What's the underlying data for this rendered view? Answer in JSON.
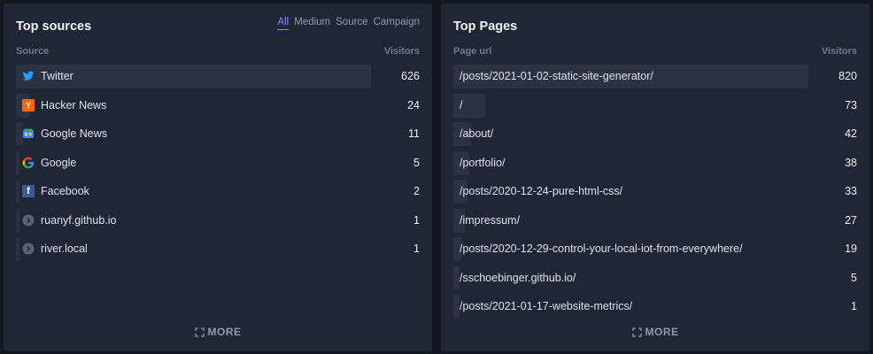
{
  "sources": {
    "title": "Top sources",
    "tabs": [
      "All",
      "Medium",
      "Source",
      "Campaign"
    ],
    "active_tab": "All",
    "col_left": "Source",
    "col_right": "Visitors",
    "rows": [
      {
        "label": "Twitter",
        "value": "626",
        "share": 1.0,
        "icon": "twitter-icon"
      },
      {
        "label": "Hacker News",
        "value": "24",
        "share": 0.04,
        "icon": "hacker-news-icon"
      },
      {
        "label": "Google News",
        "value": "11",
        "share": 0.02,
        "icon": "google-news-icon"
      },
      {
        "label": "Google",
        "value": "5",
        "share": 0.01,
        "icon": "google-icon"
      },
      {
        "label": "Facebook",
        "value": "2",
        "share": 0.005,
        "icon": "facebook-icon"
      },
      {
        "label": "ruanyf.github.io",
        "value": "1",
        "share": 0.005,
        "icon": "generic-site-icon"
      },
      {
        "label": "river.local",
        "value": "1",
        "share": 0.005,
        "icon": "generic-site-icon"
      }
    ],
    "more_label": "MORE"
  },
  "pages": {
    "title": "Top Pages",
    "col_left": "Page url",
    "col_right": "Visitors",
    "rows": [
      {
        "label": "/posts/2021-01-02-static-site-generator/",
        "value": "820",
        "share": 1.0
      },
      {
        "label": "/",
        "value": "73",
        "share": 0.089
      },
      {
        "label": "/about/",
        "value": "42",
        "share": 0.051
      },
      {
        "label": "/portfolio/",
        "value": "38",
        "share": 0.046
      },
      {
        "label": "/posts/2020-12-24-pure-html-css/",
        "value": "33",
        "share": 0.04
      },
      {
        "label": "/impressum/",
        "value": "27",
        "share": 0.033
      },
      {
        "label": "/posts/2020-12-29-control-your-local-iot-from-everywhere/",
        "value": "19",
        "share": 0.023
      },
      {
        "label": "/sschoebinger.github.io/",
        "value": "5",
        "share": 0.006
      },
      {
        "label": "/posts/2021-01-17-website-metrics/",
        "value": "1",
        "share": 0.005
      }
    ],
    "more_label": "MORE"
  },
  "colors": {
    "background": "#131720",
    "panel": "#1f2735",
    "bar": "#2b3342",
    "accent": "#818cf8",
    "twitter": "#1da1f2",
    "hacker_news": "#ff6600",
    "facebook": "#3b5998"
  }
}
